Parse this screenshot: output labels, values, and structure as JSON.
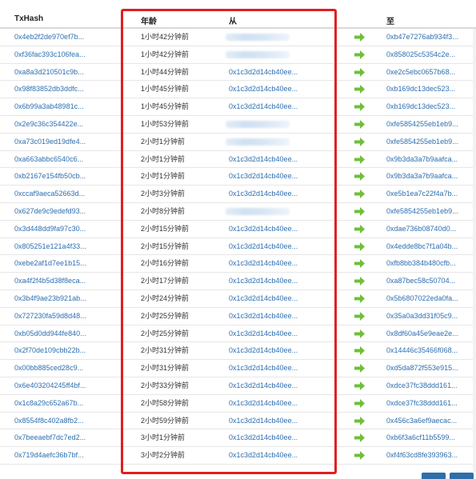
{
  "columns": {
    "hash": "TxHash",
    "age": "年龄",
    "from": "从",
    "to": "至"
  },
  "rows": [
    {
      "hash": "0x4eb2f2de970ef7b...",
      "age": "1小时42分钟前",
      "from": "",
      "to": "0xb47e7276ab934f3..."
    },
    {
      "hash": "0xf36fac393c106fea...",
      "age": "1小时42分钟前",
      "from": "",
      "to": "0x858025c5354c2e..."
    },
    {
      "hash": "0xa8a3d210501c9b...",
      "age": "1小时44分钟前",
      "from": "0x1c3d2d14cb40ee...",
      "to": "0xe2c5ebc0657b68..."
    },
    {
      "hash": "0x98f83852db3ddfc...",
      "age": "1小时45分钟前",
      "from": "0x1c3d2d14cb40ee...",
      "to": "0xb169dc13dec523..."
    },
    {
      "hash": "0x6b99a3ab48981c...",
      "age": "1小时45分钟前",
      "from": "0x1c3d2d14cb40ee...",
      "to": "0xb169dc13dec523..."
    },
    {
      "hash": "0x2e9c36c354422e...",
      "age": "1小时53分钟前",
      "from": "",
      "to": "0xfe5854255eb1eb9..."
    },
    {
      "hash": "0xa73c019ed19dfe4...",
      "age": "2小时1分钟前",
      "from": "",
      "to": "0xfe5854255eb1eb9..."
    },
    {
      "hash": "0xa663abbc6540c6...",
      "age": "2小时1分钟前",
      "from": "0x1c3d2d14cb40ee...",
      "to": "0x9b3da3a7b9aafca..."
    },
    {
      "hash": "0xb2167e154fb50cb...",
      "age": "2小时1分钟前",
      "from": "0x1c3d2d14cb40ee...",
      "to": "0x9b3da3a7b9aafca..."
    },
    {
      "hash": "0xccaf9aeca52663d...",
      "age": "2小时3分钟前",
      "from": "0x1c3d2d14cb40ee...",
      "to": "0xe5b1ea7c22f4a7b..."
    },
    {
      "hash": "0x627de9c9edefd93...",
      "age": "2小时8分钟前",
      "from": "",
      "to": "0xfe5854255eb1eb9..."
    },
    {
      "hash": "0x3d448dd9fa97c30...",
      "age": "2小时15分钟前",
      "from": "0x1c3d2d14cb40ee...",
      "to": "0xdae736b08740d0..."
    },
    {
      "hash": "0x805251e121a4f33...",
      "age": "2小时15分钟前",
      "from": "0x1c3d2d14cb40ee...",
      "to": "0x4edde8bc7f1a04b..."
    },
    {
      "hash": "0xebe2af1d7ee1b15...",
      "age": "2小时16分钟前",
      "from": "0x1c3d2d14cb40ee...",
      "to": "0xfb8bb384b480cfb..."
    },
    {
      "hash": "0xa4f2f4b5d38f8eca...",
      "age": "2小时17分钟前",
      "from": "0x1c3d2d14cb40ee...",
      "to": "0xa87bec58c50704..."
    },
    {
      "hash": "0x3b4f9ae23b921ab...",
      "age": "2小时24分钟前",
      "from": "0x1c3d2d14cb40ee...",
      "to": "0x5b6807022eda0fa..."
    },
    {
      "hash": "0x727230fa59d8d48...",
      "age": "2小时25分钟前",
      "from": "0x1c3d2d14cb40ee...",
      "to": "0x35a0a3dd31f05c9..."
    },
    {
      "hash": "0xb05d0dd944fe840...",
      "age": "2小时25分钟前",
      "from": "0x1c3d2d14cb40ee...",
      "to": "0x8df60a45e9eae2e..."
    },
    {
      "hash": "0x2f70de109cbb22b...",
      "age": "2小时31分钟前",
      "from": "0x1c3d2d14cb40ee...",
      "to": "0x14446c35466f068..."
    },
    {
      "hash": "0x00bb885ced28c9...",
      "age": "2小时31分钟前",
      "from": "0x1c3d2d14cb40ee...",
      "to": "0xd5da872f553e915..."
    },
    {
      "hash": "0x6e403204245ff4bf...",
      "age": "2小时33分钟前",
      "from": "0x1c3d2d14cb40ee...",
      "to": "0xdce37fc38ddd161..."
    },
    {
      "hash": "0x1c8a29c652a67b...",
      "age": "2小时58分钟前",
      "from": "0x1c3d2d14cb40ee...",
      "to": "0xdce37fc38ddd161..."
    },
    {
      "hash": "0x8554f8c402a8fb2...",
      "age": "2小时59分钟前",
      "from": "0x1c3d2d14cb40ee...",
      "to": "0x456c3a6ef9aecac..."
    },
    {
      "hash": "0x7beeaebf7dc7ed2...",
      "age": "3小时1分钟前",
      "from": "0x1c3d2d14cb40ee...",
      "to": "0xb6f3a6cf11b5599..."
    },
    {
      "hash": "0x719d4aefc36b7bf...",
      "age": "3小时2分钟前",
      "from": "0x1c3d2d14cb40ee...",
      "to": "0xf4f63cd8fe393963..."
    }
  ],
  "icons": {
    "direction": "arrow-right-icon"
  },
  "colors": {
    "link": "#2d6fb1",
    "arrow": "#6fbf3a",
    "highlight_box": "#e02020"
  }
}
